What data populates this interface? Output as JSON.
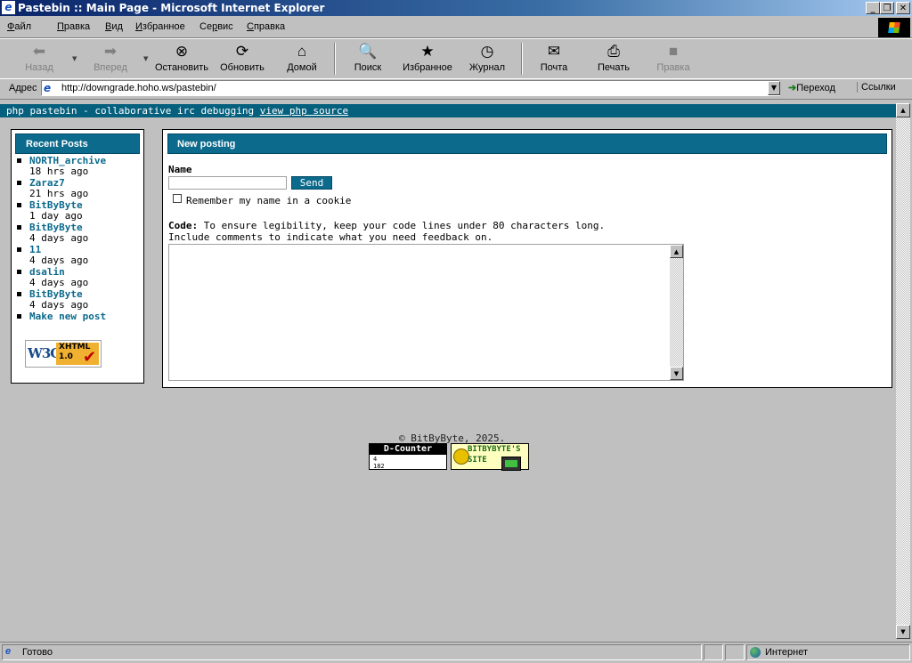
{
  "window": {
    "title": "Pastebin :: Main Page - Microsoft Internet Explorer",
    "app_icon": "e",
    "controls": {
      "minimize": "_",
      "restore": "❐",
      "close": "✕"
    }
  },
  "menu": [
    {
      "pre": "",
      "u": "Ф",
      "post": "айл"
    },
    {
      "pre": "",
      "u": "П",
      "post": "равка"
    },
    {
      "pre": "",
      "u": "В",
      "post": "ид"
    },
    {
      "pre": "",
      "u": "И",
      "post": "збранное"
    },
    {
      "pre": "Се",
      "u": "р",
      "post": "вис"
    },
    {
      "pre": "",
      "u": "С",
      "post": "правка"
    }
  ],
  "toolbar": {
    "back": {
      "label": "Назад",
      "icon": "left-arrow-icon",
      "glyph": "⬅"
    },
    "forward": {
      "label": "Вперед",
      "icon": "right-arrow-icon",
      "glyph": "➡"
    },
    "stop": {
      "label": "Остановить",
      "icon": "stop-icon",
      "glyph": "⊗"
    },
    "refresh": {
      "label": "Обновить",
      "icon": "refresh-icon",
      "glyph": "⟳"
    },
    "home": {
      "label": "Домой",
      "icon": "home-icon",
      "glyph": "⌂"
    },
    "search": {
      "label": "Поиск",
      "icon": "search-icon",
      "glyph": "🔍"
    },
    "favorites": {
      "label": "Избранное",
      "icon": "favorites-icon",
      "glyph": "★"
    },
    "history": {
      "label": "Журнал",
      "icon": "history-icon",
      "glyph": "◷"
    },
    "mail": {
      "label": "Почта",
      "icon": "mail-icon",
      "glyph": "✉"
    },
    "print": {
      "label": "Печать",
      "icon": "print-icon",
      "glyph": "⎙"
    },
    "edit": {
      "label": "Правка",
      "icon": "edit-icon",
      "glyph": "■"
    }
  },
  "address": {
    "label": "Адрес",
    "url": "http://downgrade.hoho.ws/pastebin/",
    "go": "Переход",
    "links": "Ссылки"
  },
  "page": {
    "topbar_text": "php pastebin - collaborative irc debugging ",
    "topbar_link": "view php source",
    "recent_title": "Recent Posts",
    "recent_posts": [
      {
        "name": "NORTH_archive",
        "time": "18 hrs ago"
      },
      {
        "name": "Zaraz7",
        "time": "21 hrs ago"
      },
      {
        "name": "BitByByte",
        "time": "1 day ago"
      },
      {
        "name": "BitByByte",
        "time": "4 days ago"
      },
      {
        "name": "11",
        "time": "4 days ago"
      },
      {
        "name": "dsalin",
        "time": "4 days ago"
      },
      {
        "name": "BitByByte",
        "time": "4 days ago"
      }
    ],
    "make_new_post": "Make new post",
    "w3c_badge": {
      "w3c": "W3C",
      "line1": "XHTML",
      "line2": "1.0"
    },
    "new_posting_title": "New posting",
    "name_label": "Name",
    "name_value": "",
    "send_label": "Send",
    "remember_label": "Remember my name in a cookie",
    "code_label": "Code:",
    "code_hint_1": " To ensure legibility, keep your code lines under 80 characters long.",
    "code_hint_2": "Include comments to indicate what you need feedback on.",
    "copyright": "© BitByByte, 2025.",
    "counter": {
      "title": "D-Counter",
      "today": "4",
      "total": "182"
    },
    "site_badge": {
      "line1": "BITBYBYTE'S",
      "line2": "SITE"
    }
  },
  "status": {
    "text": "Готово",
    "zone": "Интернет"
  }
}
